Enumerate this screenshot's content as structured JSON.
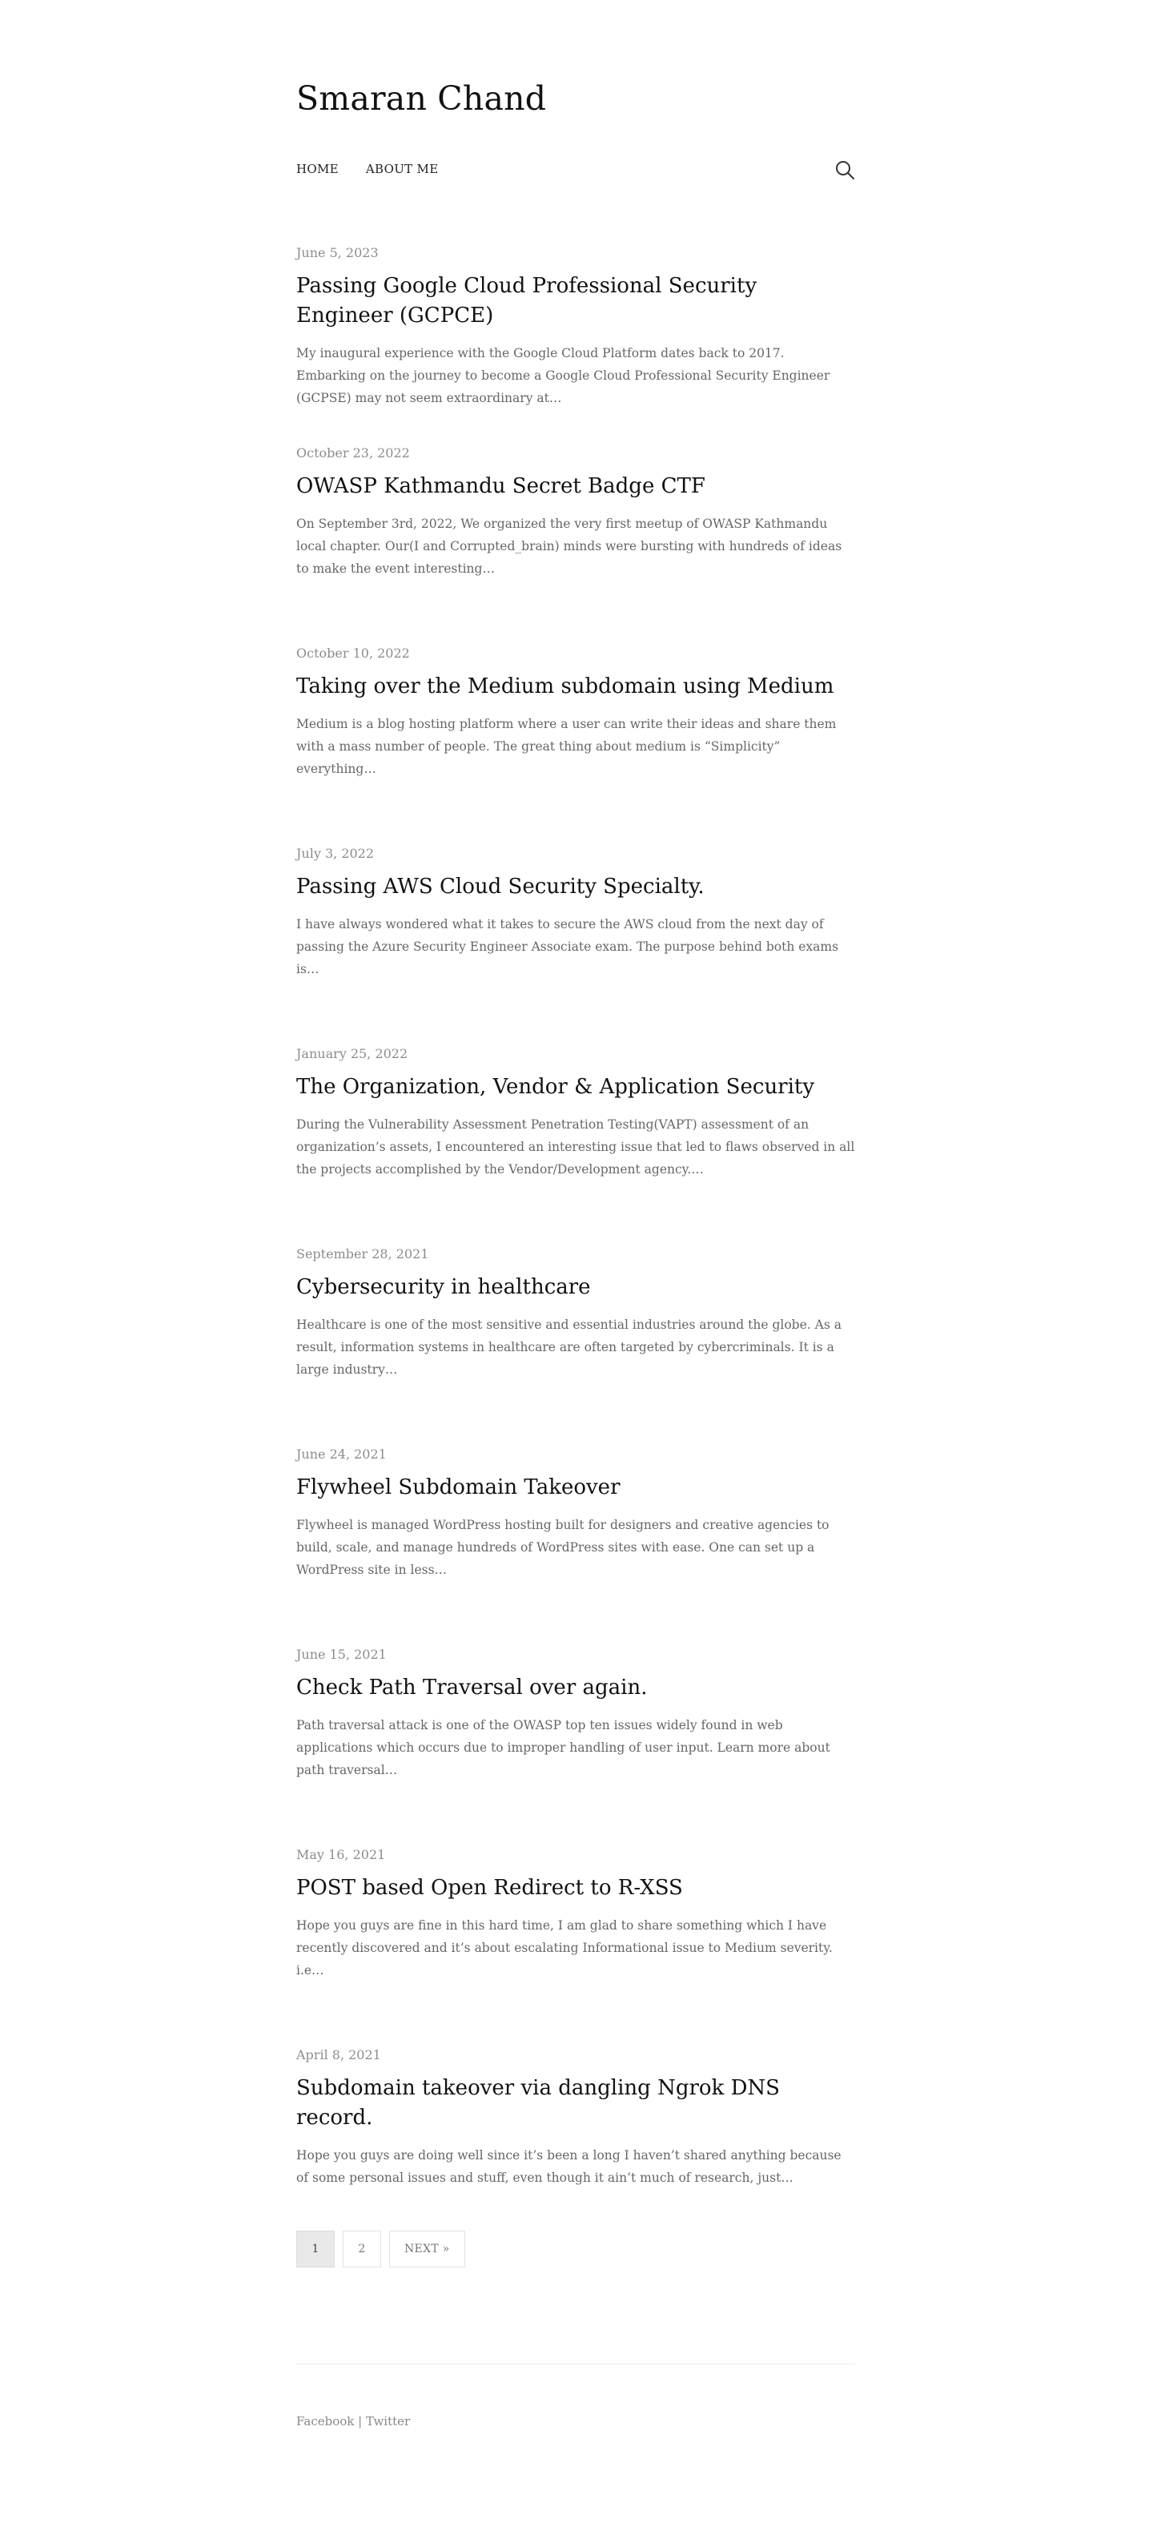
{
  "site": {
    "title": "Smaran Chand"
  },
  "nav": {
    "items": [
      {
        "label": "HOME"
      },
      {
        "label": "ABOUT ME"
      }
    ],
    "search_icon": "search-icon"
  },
  "posts": [
    {
      "date": "June 5, 2023",
      "title": "Passing Google Cloud Professional Security Engineer (GCPCE)",
      "excerpt": "My inaugural experience with the Google Cloud Platform dates back to 2017. Embarking on the journey to become a Google Cloud Professional Security Engineer (GCPSE) may not seem extraordinary at…"
    },
    {
      "date": "October 23, 2022",
      "title": "OWASP Kathmandu Secret Badge CTF",
      "excerpt": "On September 3rd, 2022, We organized the very first meetup of OWASP Kathmandu local chapter. Our(I and Corrupted_brain) minds were bursting with hundreds of ideas to make the event interesting…"
    },
    {
      "date": "October 10, 2022",
      "title": "Taking over the Medium subdomain using Medium",
      "excerpt": "Medium is a blog hosting platform where a user can write their ideas and share them with a mass number of people. The great thing about medium is “Simplicity” everything…"
    },
    {
      "date": "July 3, 2022",
      "title": "Passing AWS Cloud Security Specialty.",
      "excerpt": "I have always wondered what it takes to secure the AWS cloud from the next day of passing the Azure Security Engineer Associate exam. The purpose behind both exams is…"
    },
    {
      "date": "January 25, 2022",
      "title": "The Organization, Vendor & Application Security",
      "excerpt": "During the Vulnerability Assessment Penetration Testing(VAPT) assessment of an organization’s assets, I encountered an interesting issue that led to flaws observed in all the projects accomplished by the Vendor/Development agency.…"
    },
    {
      "date": "September 28, 2021",
      "title": "Cybersecurity in healthcare",
      "excerpt": "Healthcare is one of the most sensitive and essential industries around the globe. As a result, information systems in healthcare are often targeted by cybercriminals. It is a large industry…"
    },
    {
      "date": "June 24, 2021",
      "title": "Flywheel Subdomain Takeover",
      "excerpt": "Flywheel is managed WordPress hosting built for designers and creative agencies to build, scale, and manage hundreds of WordPress sites with ease. One can set up a WordPress site in less…"
    },
    {
      "date": "June 15, 2021",
      "title": "Check Path Traversal over again.",
      "excerpt": "Path traversal attack is one of the OWASP top ten issues widely found in web applications which occurs due to improper handling of user input. Learn more about path traversal…"
    },
    {
      "date": "May 16, 2021",
      "title": "POST based Open Redirect to R-XSS",
      "excerpt": "Hope you guys are fine in this hard time, I am glad to share something which I have recently discovered and it’s about escalating Informational issue to Medium severity. i.e…"
    },
    {
      "date": "April 8, 2021",
      "title": "Subdomain takeover via dangling Ngrok DNS record.",
      "excerpt": "Hope you guys are doing well since it’s been a long I haven’t shared anything because of some personal issues and stuff, even though it ain’t much of research, just…"
    }
  ],
  "pagination": {
    "pages": [
      "1",
      "2"
    ],
    "next_label": "NEXT »"
  },
  "footer": {
    "facebook": "Facebook",
    "separator": " | ",
    "twitter": "Twitter"
  }
}
